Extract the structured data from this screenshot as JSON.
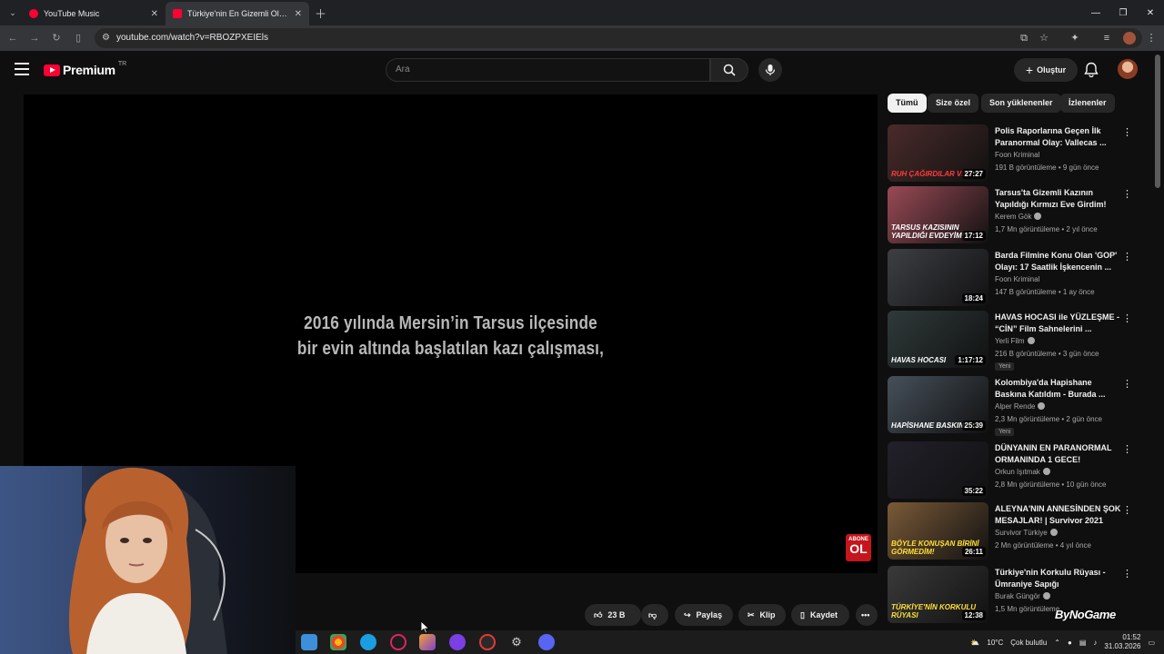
{
  "browser": {
    "tabs": [
      {
        "title": "YouTube Music",
        "active": false
      },
      {
        "title": "Türkiye'nin En Gizemli Olayı: Tarsus",
        "active": true
      }
    ],
    "url": "youtube.com/watch?v=RBOZPXEIEls"
  },
  "youtube": {
    "logo_word": "Premium",
    "country_code": "TR",
    "search_placeholder": "Ara",
    "create_label": "Oluştur"
  },
  "player": {
    "subtitle_line1": "2016 yılında Mersin’in Tarsus ilçesinde",
    "subtitle_line2": "bir evin altında başlatılan kazı çalışması,",
    "subscribe_small": "ABONE",
    "subscribe_big": "OL"
  },
  "actions": {
    "likes": "23 B",
    "share": "Paylaş",
    "clip": "Klip",
    "save": "Kaydet"
  },
  "chips": [
    "Tümü",
    "Size özel",
    "Son yüklenenler",
    "İzlenenler"
  ],
  "recommendations": [
    {
      "title": "Polis Raporlarına Geçen İlk Paranormal Olay: Vallecas ...",
      "channel": "Foon Kriminal",
      "verified": false,
      "views": "191 B görüntüleme • 9 gün önce",
      "duration": "27:27",
      "caption": "RUH ÇAĞIRDILAR VE...",
      "caption_color": "#ff3b3b",
      "thumb_color": "#4a2b2a",
      "new": ""
    },
    {
      "title": "Tarsus'ta Gizemli Kazının Yapıldığı Kırmızı Eve Girdim!",
      "channel": "Kerem Gök",
      "verified": true,
      "views": "1,7 Mn görüntüleme • 2 yıl önce",
      "duration": "17:12",
      "caption": "TARSUS KAZISININ YAPILDIĞI EVDEYİM!",
      "caption_color": "#ffffff",
      "thumb_color": "#9a4a56",
      "new": ""
    },
    {
      "title": "Barda Filmine Konu Olan 'GOP' Olayı: 17 Saatlik İşkencenin ...",
      "channel": "Foon Kriminal",
      "verified": false,
      "views": "147 B görüntüleme • 1 ay önce",
      "duration": "18:24",
      "caption": "",
      "caption_color": "#ffffff",
      "thumb_color": "#3d3f44",
      "new": ""
    },
    {
      "title": "HAVAS HOCASI ile YÜZLEŞME - “CİN” Film Sahnelerini ...",
      "channel": "Yerli Film",
      "verified": true,
      "views": "216 B görüntüleme • 3 gün önce",
      "duration": "1:17:12",
      "caption": "HAVAS HOCASI",
      "caption_color": "#ffffff",
      "thumb_color": "#2f3a3a",
      "new": "Yeni"
    },
    {
      "title": "Kolombiya'da Hapishane Baskına Katıldım - Burada ...",
      "channel": "Alper Rende",
      "verified": true,
      "views": "2,3 Mn görüntüleme • 2 gün önce",
      "duration": "25:39",
      "caption": "HAPİSHANE BASKINI",
      "caption_color": "#ffffff",
      "thumb_color": "#46505a",
      "new": "Yeni"
    },
    {
      "title": "DÜNYANIN EN PARANORMAL ORMANINDA 1 GECE!",
      "channel": "Orkun Işıtmak",
      "verified": true,
      "views": "2,8 Mn görüntüleme • 10 gün önce",
      "duration": "35:22",
      "caption": "",
      "caption_color": "#ffffff",
      "thumb_color": "#22202a",
      "new": ""
    },
    {
      "title": "ALEYNA'NIN ANNESİNDEN ŞOK MESAJLAR! | Survivor 2021",
      "channel": "Survivor Türkiye",
      "verified": true,
      "views": "2 Mn görüntüleme • 4 yıl önce",
      "duration": "26:11",
      "caption": "BÖYLE KONUŞAN BİRİNİ GÖRMEDİM!",
      "caption_color": "#ffe033",
      "thumb_color": "#7a5a38",
      "new": ""
    },
    {
      "title": "Türkiye'nin Korkulu Rüyası - Ümraniye Sapığı",
      "channel": "Burak Güngör",
      "verified": true,
      "views": "1,5 Mn görüntüleme",
      "duration": "12:38",
      "caption": "TÜRKİYE'NİN KORKULU RÜYASI",
      "caption_color": "#ffe033",
      "thumb_color": "#3a3a3a",
      "new": ""
    }
  ],
  "taskbar": {
    "temperature": "10°C",
    "weather": "Çok bulutlu",
    "time": "01:52",
    "date": "31.03.2026"
  },
  "overlay": {
    "watermark": "ByNoGame"
  }
}
